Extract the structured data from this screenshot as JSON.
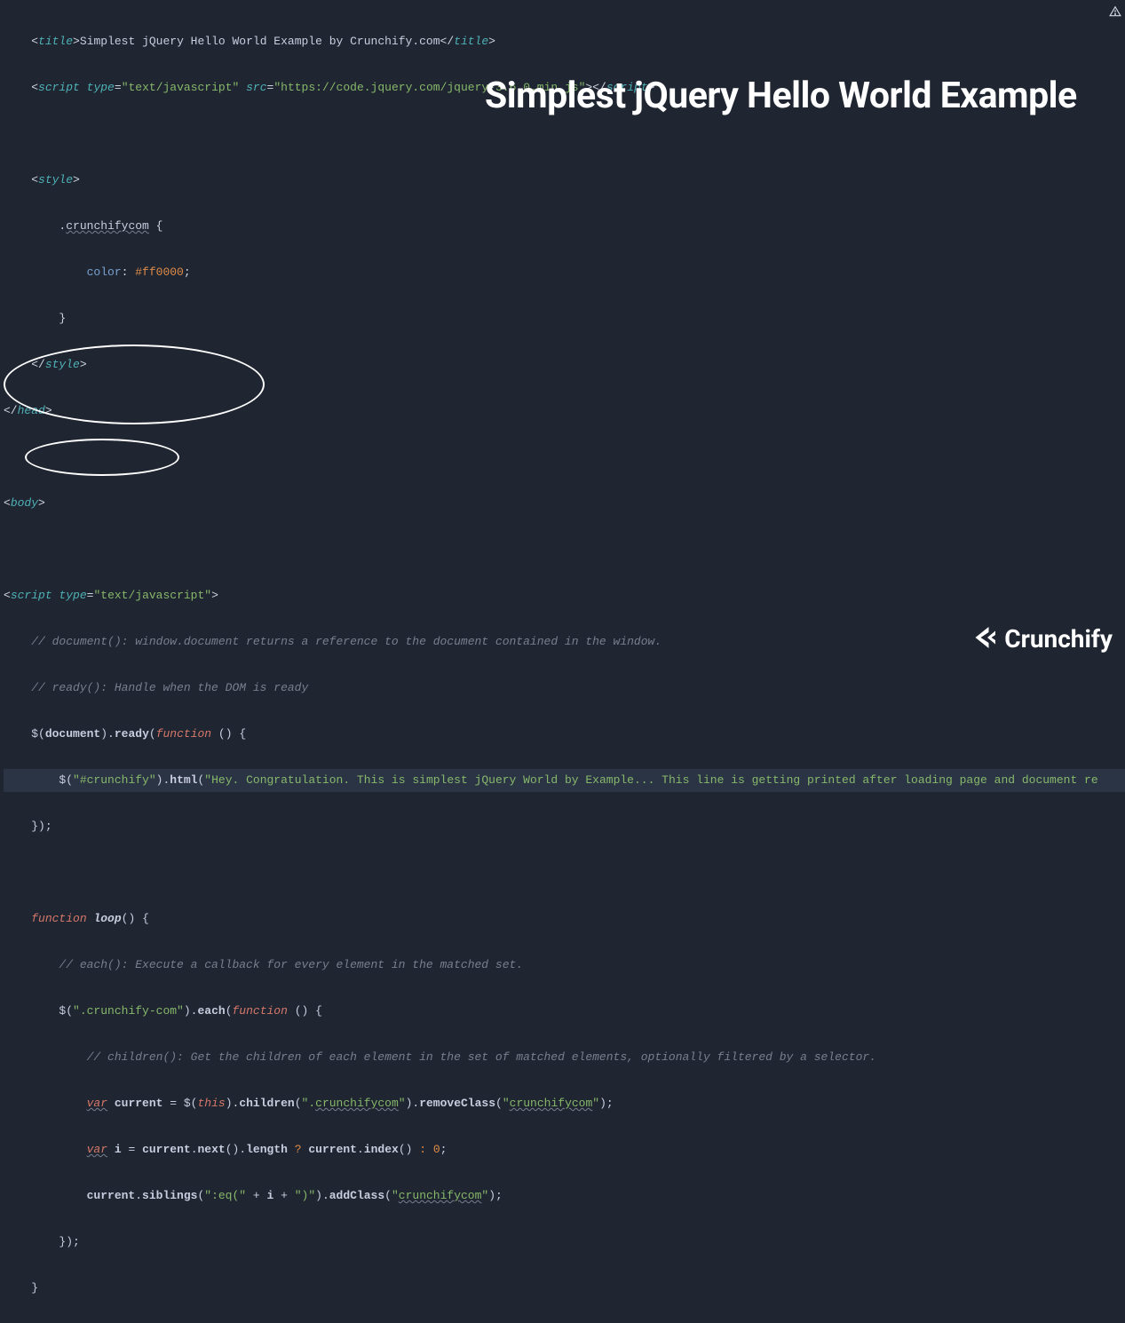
{
  "overlay": {
    "title": "Simplest jQuery Hello World Example"
  },
  "logo": {
    "text": "Crunchify"
  },
  "code": {
    "title_text": "Simplest jQuery Hello World Example by Crunchify.com",
    "script_type": "\"text/javascript\"",
    "script_src": "\"https://code.jquery.com/jquery-3.6.0.min.js\"",
    "css_class": "crunchifycom",
    "css_prop": "color",
    "css_value": "#ff0000",
    "cmt1": "// document(): window.document returns a reference to the document contained in the window.",
    "cmt2": "// ready(): Handle when the DOM is ready",
    "ready_sel": "\"#crunchify\"",
    "ready_html": "\"Hey. Congratulation. This is simplest jQuery World by Example... This line is getting printed after loading page and document re",
    "loop_name": "loop",
    "cmt3": "// each(): Execute a callback for every element in the matched set.",
    "each_sel": "\".crunchify-com\"",
    "cmt4": "// children(): Get the children of each element in the set of matched elements, optionally filtered by a selector.",
    "children_sel": "\".",
    "children_sel2": "crunchifycom",
    "children_sel3": "\"",
    "removeclass_arg": "crunchifycom",
    "zero": "0",
    "eq_open": "\":eq(\"",
    "eq_close": "\")\"",
    "addclass_arg": "crunchifycom"
  }
}
